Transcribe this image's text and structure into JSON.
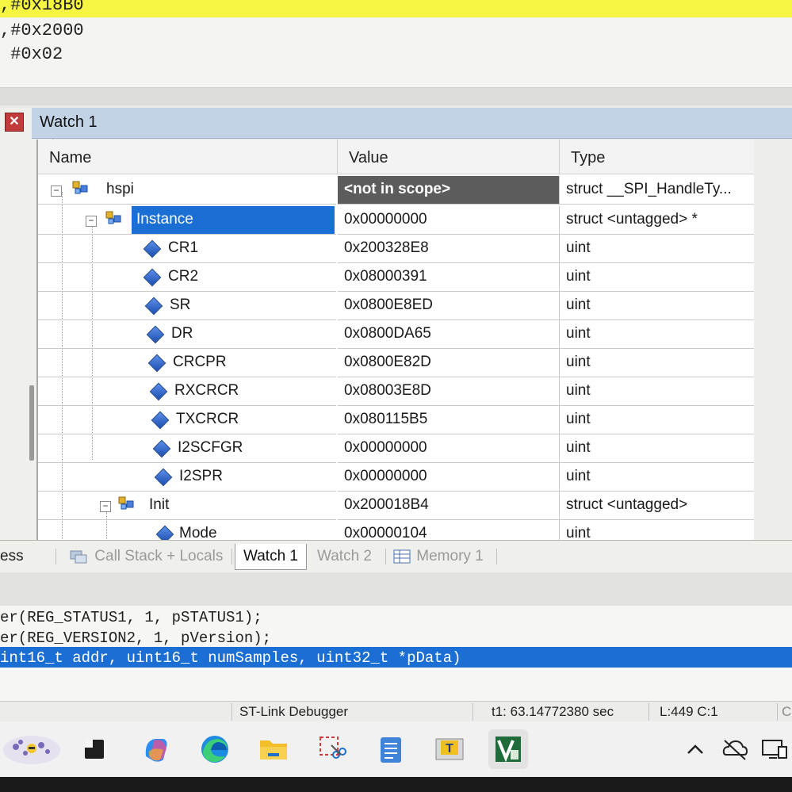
{
  "code_top": {
    "lines": [
      ",#0x18B0",
      ",#0x2000",
      " #0x02"
    ]
  },
  "watch": {
    "title": "Watch 1",
    "columns": {
      "name": "Name",
      "value": "Value",
      "type": "Type"
    },
    "rows": [
      {
        "name": "hspi",
        "value": "<not in scope>",
        "type": "struct __SPI_HandleTy..."
      },
      {
        "name": "Instance",
        "value": "0x00000000",
        "type": "struct <untagged> *"
      },
      {
        "name": "CR1",
        "value": "0x200328E8",
        "type": "uint"
      },
      {
        "name": "CR2",
        "value": "0x08000391",
        "type": "uint"
      },
      {
        "name": "SR",
        "value": "0x0800E8ED",
        "type": "uint"
      },
      {
        "name": "DR",
        "value": "0x0800DA65",
        "type": "uint"
      },
      {
        "name": "CRCPR",
        "value": "0x0800E82D",
        "type": "uint"
      },
      {
        "name": "RXCRCR",
        "value": "0x08003E8D",
        "type": "uint"
      },
      {
        "name": "TXCRCR",
        "value": "0x080115B5",
        "type": "uint"
      },
      {
        "name": "I2SCFGR",
        "value": "0x00000000",
        "type": "uint"
      },
      {
        "name": "I2SPR",
        "value": "0x00000000",
        "type": "uint"
      },
      {
        "name": "Init",
        "value": "0x200018B4",
        "type": "struct <untagged>"
      },
      {
        "name": "Mode",
        "value": "0x00000104",
        "type": "uint"
      }
    ]
  },
  "tabs": {
    "left_partial": "ess",
    "call_stack": "Call Stack + Locals",
    "watch1": "Watch 1",
    "watch2": "Watch 2",
    "memory1": "Memory 1"
  },
  "code_bottom": {
    "lines": [
      "er(REG_STATUS1, 1, pSTATUS1);",
      "er(REG_VERSION2, 1, pVersion);",
      "int16_t addr, uint16_t numSamples, uint32_t *pData)"
    ]
  },
  "status": {
    "debugger": "ST-Link Debugger",
    "time": "t1: 63.14772380 sec",
    "position": "L:449 C:1",
    "extra": "C"
  },
  "taskbar": {
    "apps": [
      "lavender-widget",
      "terminal-icon",
      "copilot-icon",
      "edge-icon",
      "file-explorer-icon",
      "snipping-tool-icon",
      "notepad-icon",
      "text-app-icon",
      "keil-uvision-icon"
    ],
    "tray": [
      "chevron-up-icon",
      "cloud-off-icon",
      "remote-display-icon"
    ]
  },
  "colors": {
    "selection": "#1b6ed3",
    "highlight_line": "#f5f542",
    "watch_title": "#c3d3e6"
  }
}
